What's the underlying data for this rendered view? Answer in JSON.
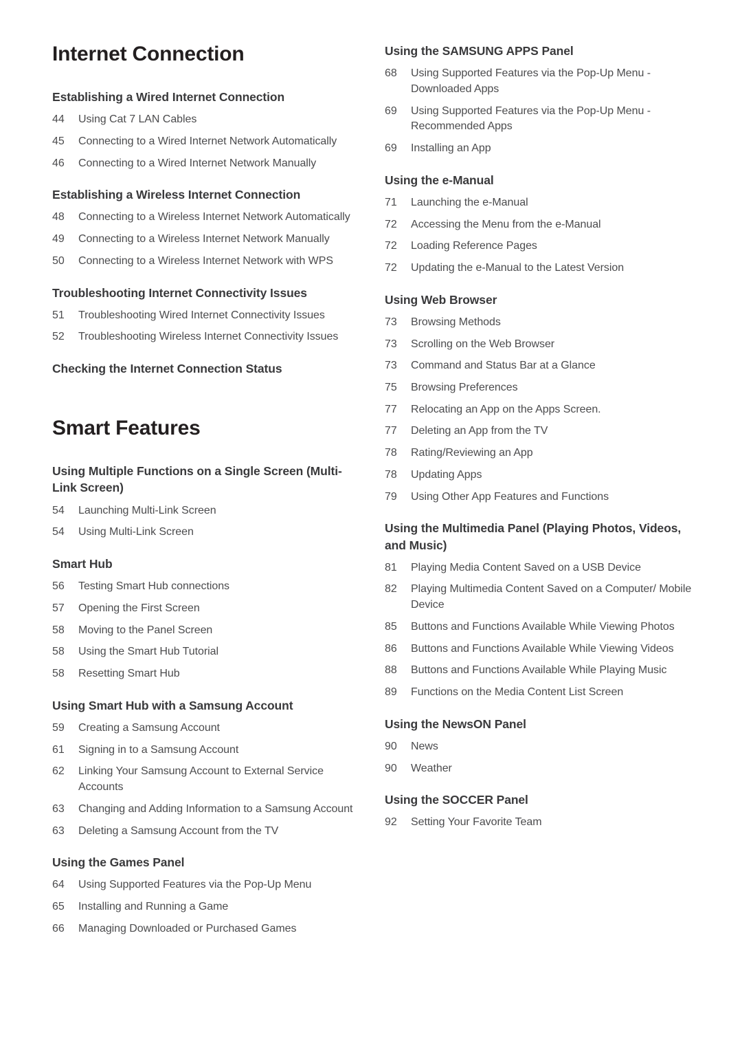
{
  "document": {
    "type": "table-of-contents",
    "background_color": "#ffffff",
    "title_color": "#231f20",
    "heading_color": "#3a3a3c",
    "entry_color": "#4b4b4d"
  },
  "left_column": {
    "parts": [
      {
        "title": "Internet Connection",
        "sections": [
          {
            "heading": "Establishing a Wired Internet Connection",
            "entries": [
              {
                "page": "44",
                "text": "Using Cat 7 LAN Cables"
              },
              {
                "page": "45",
                "text": "Connecting to a Wired Internet Network Automatically"
              },
              {
                "page": "46",
                "text": "Connecting to a Wired Internet Network Manually"
              }
            ]
          },
          {
            "heading": "Establishing a Wireless Internet Connection",
            "entries": [
              {
                "page": "48",
                "text": "Connecting to a Wireless Internet Network Automatically"
              },
              {
                "page": "49",
                "text": "Connecting to a Wireless Internet Network Manually"
              },
              {
                "page": "50",
                "text": "Connecting to a Wireless Internet Network with WPS"
              }
            ]
          },
          {
            "heading": "Troubleshooting Internet Connectivity Issues",
            "entries": [
              {
                "page": "51",
                "text": "Troubleshooting Wired Internet Connectivity Issues"
              },
              {
                "page": "52",
                "text": "Troubleshooting Wireless Internet Connectivity Issues"
              }
            ]
          },
          {
            "heading": "Checking the Internet Connection Status",
            "entries": []
          }
        ]
      },
      {
        "title": "Smart Features",
        "sections": [
          {
            "heading": "Using Multiple Functions on a Single Screen (Multi-Link Screen)",
            "entries": [
              {
                "page": "54",
                "text": "Launching Multi-Link Screen"
              },
              {
                "page": "54",
                "text": "Using Multi-Link Screen"
              }
            ]
          },
          {
            "heading": "Smart Hub",
            "entries": [
              {
                "page": "56",
                "text": "Testing Smart Hub connections"
              },
              {
                "page": "57",
                "text": "Opening the First Screen"
              },
              {
                "page": "58",
                "text": "Moving to the Panel Screen"
              },
              {
                "page": "58",
                "text": "Using the Smart Hub Tutorial"
              },
              {
                "page": "58",
                "text": "Resetting Smart Hub"
              }
            ]
          },
          {
            "heading": "Using Smart Hub with a Samsung Account",
            "entries": [
              {
                "page": "59",
                "text": "Creating a Samsung Account"
              },
              {
                "page": "61",
                "text": "Signing in to a Samsung Account"
              },
              {
                "page": "62",
                "text": "Linking Your Samsung Account to External Service Accounts"
              },
              {
                "page": "63",
                "text": "Changing and Adding Information to a Samsung Account"
              },
              {
                "page": "63",
                "text": "Deleting a Samsung Account from the TV"
              }
            ]
          },
          {
            "heading": "Using the Games Panel",
            "entries": [
              {
                "page": "64",
                "text": "Using Supported Features via the Pop-Up Menu"
              },
              {
                "page": "65",
                "text": "Installing and Running a Game"
              },
              {
                "page": "66",
                "text": "Managing Downloaded or Purchased Games"
              }
            ]
          }
        ]
      }
    ]
  },
  "right_column": {
    "sections": [
      {
        "heading": "Using the SAMSUNG APPS Panel",
        "entries": [
          {
            "page": "68",
            "text": "Using Supported Features via the Pop-Up Menu - Downloaded Apps"
          },
          {
            "page": "69",
            "text": "Using Supported Features via the Pop-Up Menu - Recommended Apps"
          },
          {
            "page": "69",
            "text": "Installing an App"
          }
        ]
      },
      {
        "heading": "Using the e-Manual",
        "entries": [
          {
            "page": "71",
            "text": "Launching the e-Manual"
          },
          {
            "page": "72",
            "text": "Accessing the Menu from the e-Manual"
          },
          {
            "page": "72",
            "text": "Loading Reference Pages"
          },
          {
            "page": "72",
            "text": "Updating the e-Manual to the Latest Version"
          }
        ]
      },
      {
        "heading": "Using Web Browser",
        "entries": [
          {
            "page": "73",
            "text": "Browsing Methods"
          },
          {
            "page": "73",
            "text": "Scrolling on the Web Browser"
          },
          {
            "page": "73",
            "text": "Command and Status Bar at a Glance"
          },
          {
            "page": "75",
            "text": "Browsing Preferences"
          },
          {
            "page": "77",
            "text": "Relocating an App on the Apps Screen."
          },
          {
            "page": "77",
            "text": "Deleting an App from the TV"
          },
          {
            "page": "78",
            "text": "Rating/Reviewing an App"
          },
          {
            "page": "78",
            "text": "Updating Apps"
          },
          {
            "page": "79",
            "text": "Using Other App Features and Functions"
          }
        ]
      },
      {
        "heading": "Using the Multimedia Panel (Playing Photos, Videos, and Music)",
        "entries": [
          {
            "page": "81",
            "text": "Playing Media Content Saved on a USB Device"
          },
          {
            "page": "82",
            "text": "Playing Multimedia Content Saved on a Computer/ Mobile Device"
          },
          {
            "page": "85",
            "text": "Buttons and Functions Available While Viewing Photos"
          },
          {
            "page": "86",
            "text": "Buttons and Functions Available While Viewing Videos"
          },
          {
            "page": "88",
            "text": "Buttons and Functions Available While Playing Music"
          },
          {
            "page": "89",
            "text": "Functions on the Media Content List Screen"
          }
        ]
      },
      {
        "heading": "Using the NewsON Panel",
        "entries": [
          {
            "page": "90",
            "text": "News"
          },
          {
            "page": "90",
            "text": "Weather"
          }
        ]
      },
      {
        "heading": "Using the SOCCER Panel",
        "entries": [
          {
            "page": "92",
            "text": "Setting Your Favorite Team"
          }
        ]
      }
    ]
  }
}
